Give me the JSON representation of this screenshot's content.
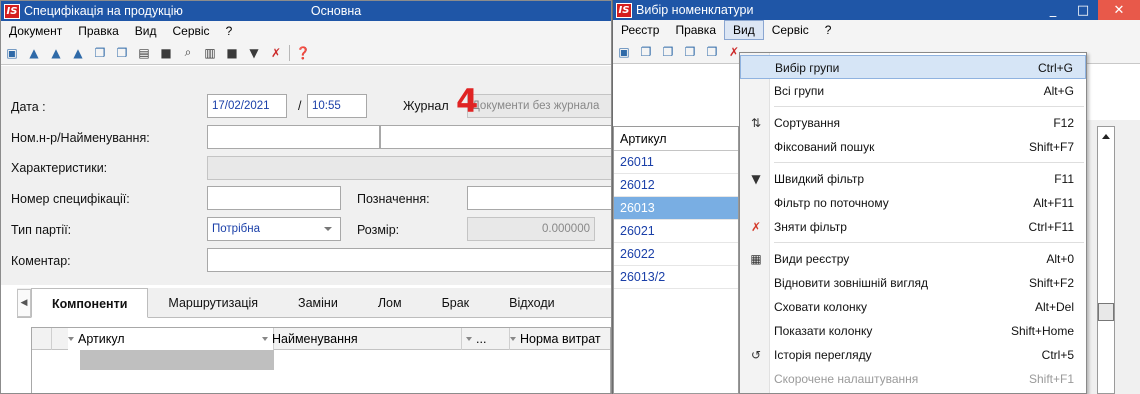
{
  "colors": {
    "titlebar": "#1f56a7",
    "selection": "#79aee3",
    "menu_highlight": "#d6e5f6",
    "annotation": "#e02424",
    "close": "#e8594a"
  },
  "win1": {
    "title": "Специфікація на продукцію",
    "title_extra": "Основна",
    "menu": [
      "Документ",
      "Правка",
      "Вид",
      "Сервіс",
      "?"
    ],
    "toolbar_icons": [
      "open-folder-icon",
      "user-icon",
      "user-add-icon",
      "user-edit-icon",
      "copy-icon",
      "copy-add-icon",
      "print-icon",
      "stop-icon",
      "search-icon",
      "columns-icon",
      "view-icon",
      "filter-icon",
      "clear-filter-icon",
      "help-icon"
    ],
    "form": {
      "date_label": "Дата :",
      "date_value": "17/02/2021",
      "time_sep": "/",
      "time_value": "10:55",
      "journal_label": "Журнал",
      "journal_value": "Документи без журнала",
      "nom_label": "Ном.н-р/Найменування:",
      "char_label": "Характеристики:",
      "spec_label": "Номер специфікації:",
      "design_label": "Позначення:",
      "batch_label": "Тип партії:",
      "batch_value": "Потрібна",
      "size_label": "Розмір:",
      "size_value": "0.000000",
      "comment_label": "Коментар:",
      "annotation": "4"
    },
    "tabs": [
      "Компоненти",
      "Маршрутизація",
      "Заміни",
      "Лом",
      "Брак",
      "Відходи"
    ],
    "grid_columns": [
      "Артикул",
      "Найменування",
      "...",
      "Норма витрат"
    ]
  },
  "win2": {
    "title": "Вибір номенклатури",
    "menu": [
      "Реєстр",
      "Правка",
      "Вид",
      "Сервіс",
      "?"
    ],
    "window_buttons": [
      "_",
      "□",
      "✕"
    ],
    "list_header": "Артикул",
    "list_rows": [
      "26011",
      "26012",
      "26013",
      "26021",
      "26022",
      "26013/2"
    ],
    "selected_row": "26013"
  },
  "dropdown": {
    "items": [
      {
        "label": "Вибір групи",
        "shortcut": "Ctrl+G",
        "icon": "",
        "highlighted": true
      },
      {
        "label": "Всі групи",
        "shortcut": "Alt+G",
        "icon": ""
      },
      {
        "label": "Сортування",
        "shortcut": "F12",
        "icon": "sort-icon",
        "sep_before": true
      },
      {
        "label": "Фіксований пошук",
        "shortcut": "Shift+F7",
        "icon": ""
      },
      {
        "label": "Швидкий фільтр",
        "shortcut": "F11",
        "icon": "filter-icon",
        "sep_before": true
      },
      {
        "label": "Фільтр по поточному",
        "shortcut": "Alt+F11",
        "icon": ""
      },
      {
        "label": "Зняти фільтр",
        "shortcut": "Ctrl+F11",
        "icon": "clear-filter-icon"
      },
      {
        "label": "Види реєстру",
        "shortcut": "Alt+0",
        "icon": "grid-icon",
        "sep_before": true
      },
      {
        "label": "Відновити зовнішній вигляд",
        "shortcut": "Shift+F2",
        "icon": ""
      },
      {
        "label": "Сховати колонку",
        "shortcut": "Alt+Del",
        "icon": ""
      },
      {
        "label": "Показати колонку",
        "shortcut": "Shift+Home",
        "icon": ""
      },
      {
        "label": "Історія перегляду",
        "shortcut": "Ctrl+5",
        "icon": "history-icon"
      },
      {
        "label": "Скорочене налаштування",
        "shortcut": "Shift+F1",
        "icon": "",
        "disabled": true
      }
    ]
  }
}
